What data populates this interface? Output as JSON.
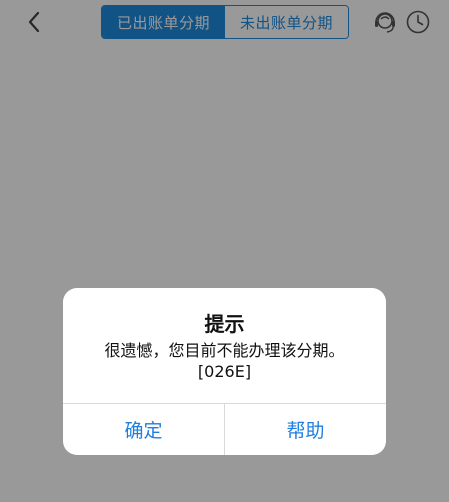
{
  "header": {
    "back_icon": "chevron-left-icon",
    "tabs": [
      {
        "label": "已出账单分期",
        "active": true
      },
      {
        "label": "未出账单分期",
        "active": false
      }
    ],
    "service_icon": "customer-service-icon",
    "history_icon": "clock-icon",
    "accent_color": "#1f8ae0"
  },
  "dialog": {
    "title": "提示",
    "message": "很遗憾，您目前不能办理该分期。",
    "code": "[026E]",
    "confirm_label": "确定",
    "help_label": "帮助",
    "button_color": "#1f7fe0"
  }
}
